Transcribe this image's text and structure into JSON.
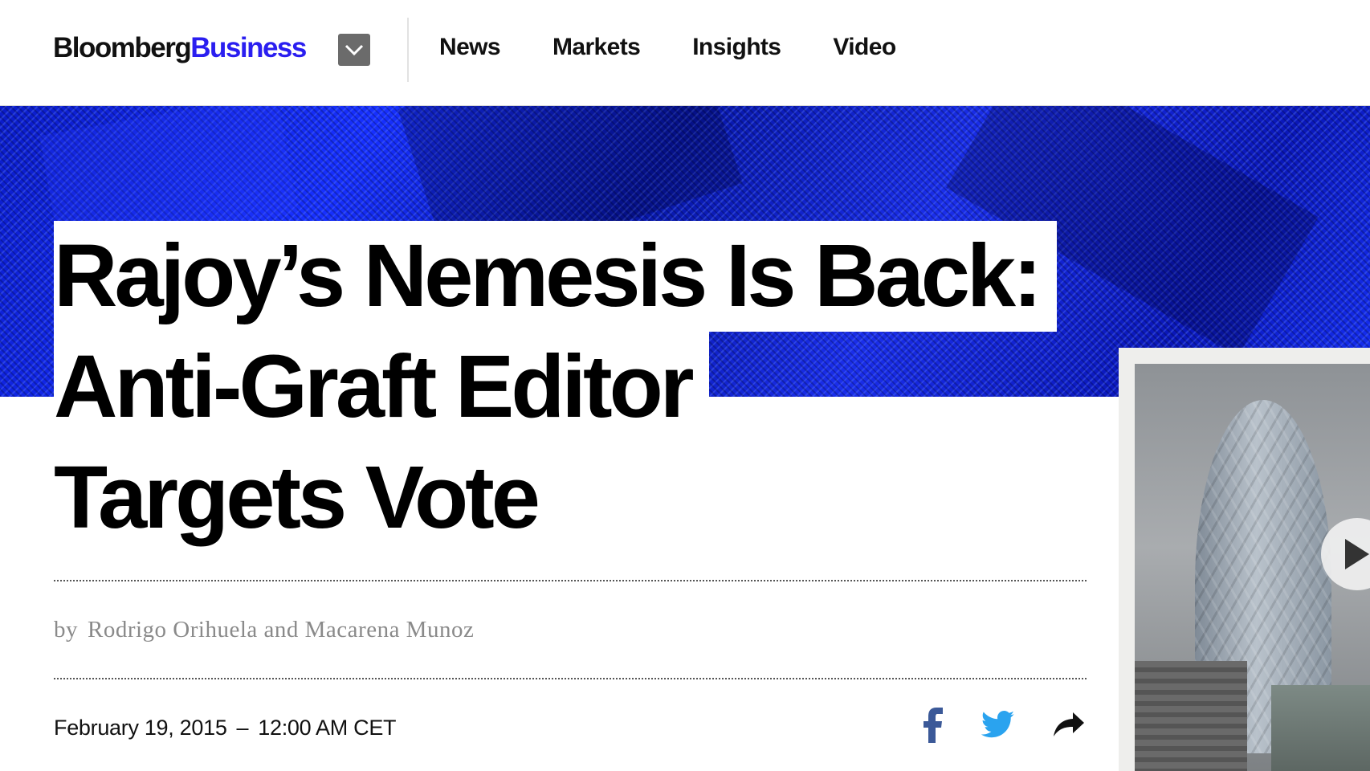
{
  "header": {
    "logo_part1": "Bloomberg",
    "logo_part2": "Business",
    "menu_icon": "chevron-down-icon",
    "nav": [
      "News",
      "Markets",
      "Insights",
      "Video"
    ]
  },
  "article": {
    "headline_lines": [
      "Rajoy’s Nemesis Is Back:",
      "Anti-Graft Editor",
      "Targets Vote"
    ],
    "byline_prefix": "by",
    "authors": "Rodrigo Orihuela and Macarena Munoz",
    "date": "February 19, 2015",
    "date_separator": "–",
    "time": "12:00 AM CET"
  },
  "share": {
    "icons": [
      "facebook-icon",
      "twitter-icon",
      "share-arrow-icon"
    ]
  },
  "colors": {
    "brand_blue": "#2a1ef0",
    "hero_blue": "#1730ff",
    "facebook": "#3b5998",
    "twitter": "#2aa3ef"
  }
}
